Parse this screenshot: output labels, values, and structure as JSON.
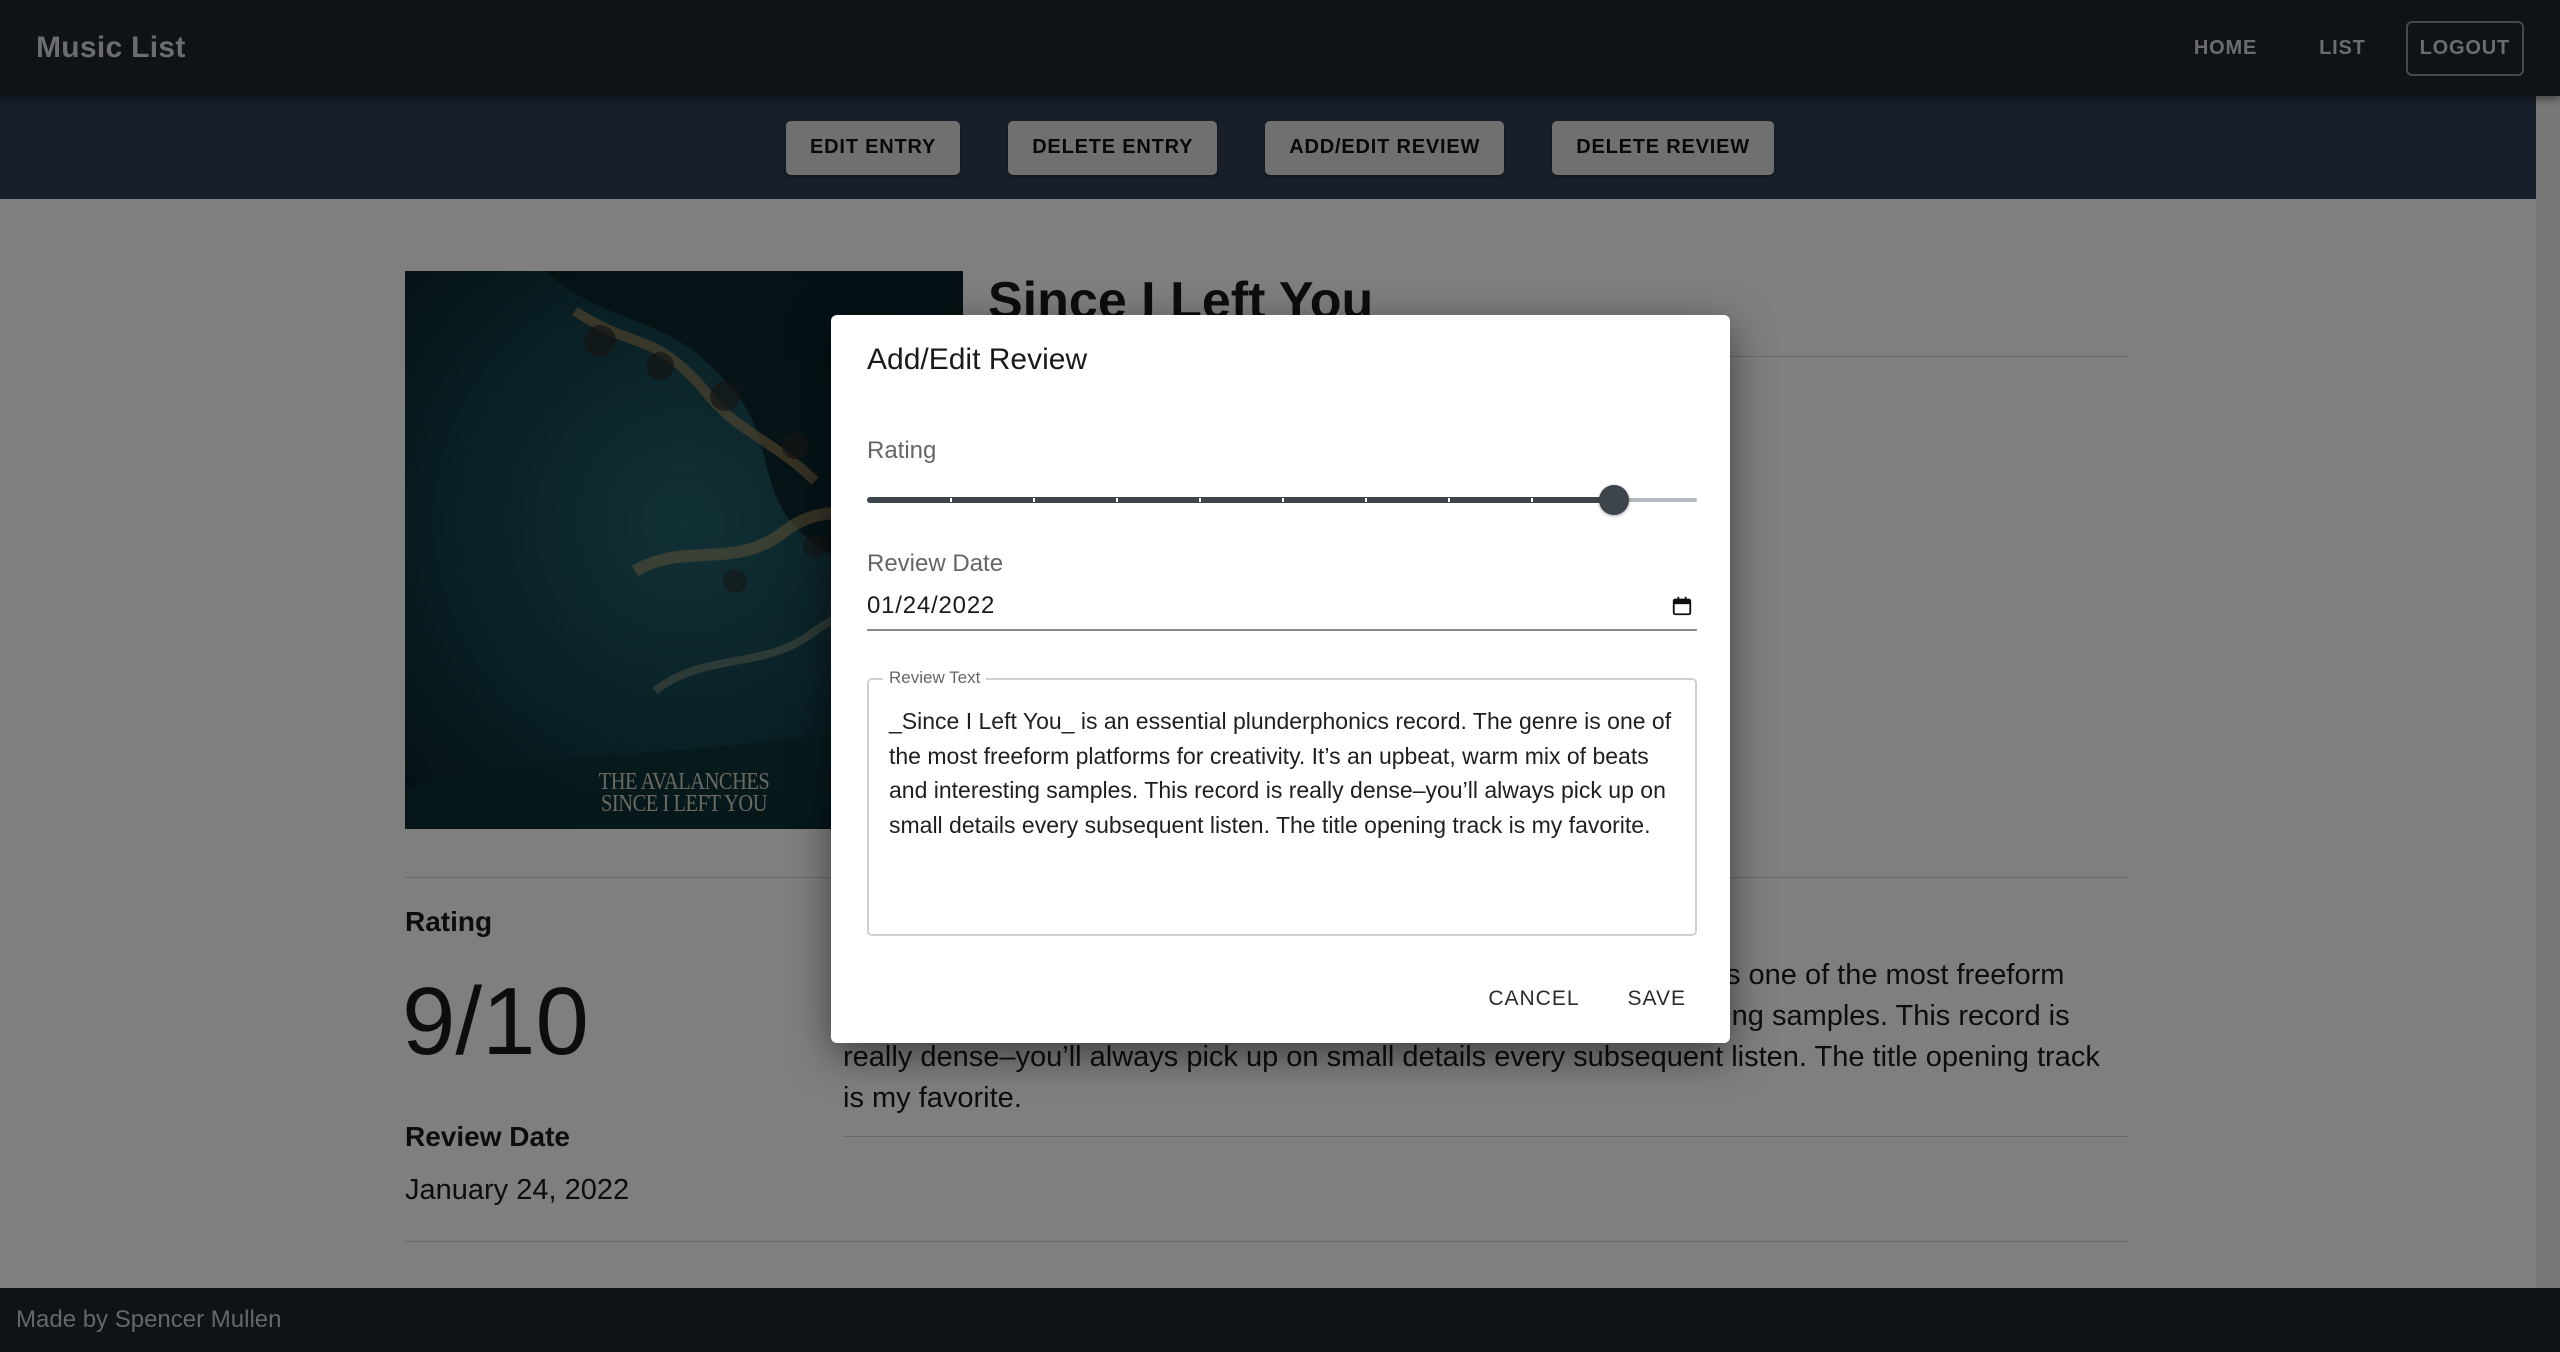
{
  "app": {
    "title": "Music List"
  },
  "nav": {
    "home": "HOME",
    "list": "LIST",
    "logout": "LOGOUT"
  },
  "actions": {
    "edit_entry": "EDIT ENTRY",
    "delete_entry": "DELETE ENTRY",
    "add_edit_review": "ADD/EDIT REVIEW",
    "delete_review": "DELETE REVIEW"
  },
  "album": {
    "title": "Since I Left You",
    "cover_text_line1": "THE AVALANCHES",
    "cover_text_line2": "SINCE I LEFT YOU"
  },
  "review": {
    "rating_label": "Rating",
    "rating_value": "9/10",
    "date_label": "Review Date",
    "date_value": "January 24, 2022",
    "text": "_Since I Left You_ is an essential plunderphonics record. The genre is one of the most freeform platforms for creativity. It’s an upbeat, warm mix of beats and interesting samples. This record is really dense–you’ll always pick up on small details every subsequent listen. The title opening track is my favorite."
  },
  "footer": {
    "text": "Made by Spencer Mullen"
  },
  "dialog": {
    "title": "Add/Edit Review",
    "rating_label": "Rating",
    "rating": {
      "value": 9,
      "min": 0,
      "max": 10,
      "step": 1
    },
    "date_label": "Review Date",
    "date_value": "01/24/2022",
    "text_label": "Review Text",
    "text_value": "_Since I Left You_ is an essential plunderphonics record. The genre is one of the most freeform platforms for creativity. It’s an upbeat, warm mix of beats and interesting samples. This record is really dense–you’ll always pick up on small details every subsequent listen. The title opening track is my favorite.",
    "cancel": "CANCEL",
    "save": "SAVE"
  },
  "colors": {
    "appbar": "#21262d",
    "actionbar": "#2e3f56",
    "slider": "#3e444c",
    "action_button": "#e0e0e0"
  },
  "icons": {
    "date_picker": "calendar-icon"
  }
}
